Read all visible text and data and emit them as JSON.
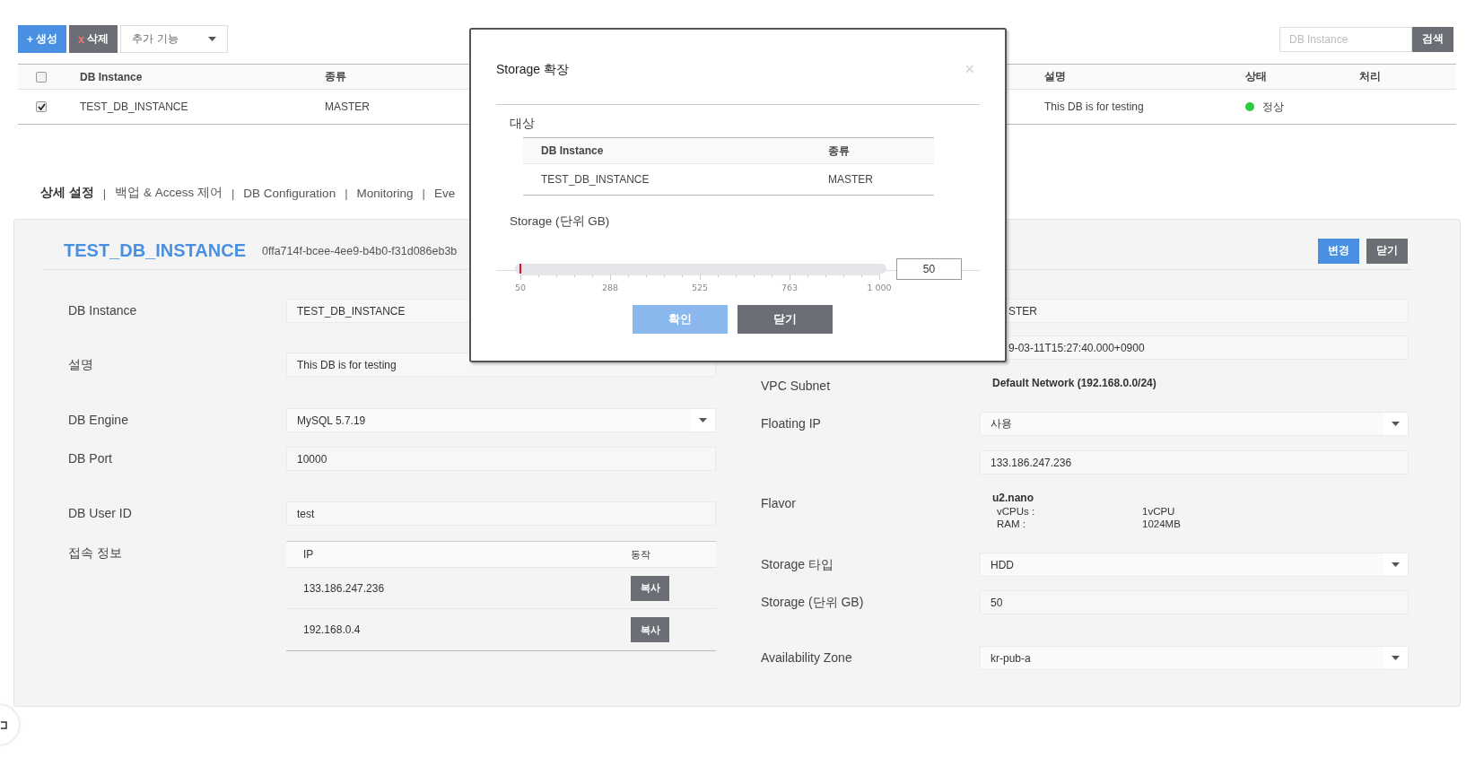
{
  "toolbar": {
    "buttons": [
      {
        "kind": "create",
        "icon": "+",
        "label": "생성"
      },
      {
        "kind": "delete",
        "icon": "x",
        "label": "삭제"
      }
    ],
    "more": {
      "label": "추가 기능"
    },
    "search": {
      "placeholder": "DB Instance",
      "button": "검색"
    }
  },
  "instances": {
    "header_checked": false,
    "columns": [
      "DB Instance",
      "종류",
      "설명",
      "상태",
      "처리"
    ],
    "rows": [
      {
        "checked": true,
        "name": "TEST_DB_INSTANCE",
        "type": "MASTER",
        "description": "This DB is for testing",
        "status": {
          "label": "정상",
          "color": "#2ecc40"
        }
      }
    ]
  },
  "tabs": [
    {
      "label": "상세 설정",
      "selected": true
    },
    {
      "label": "백업 & Access 제어",
      "selected": false
    },
    {
      "label": "DB Configuration",
      "selected": false
    },
    {
      "label": "Monitoring",
      "selected": false
    },
    {
      "label": "Eve",
      "selected": false
    }
  ],
  "tab_separators": [
    "|",
    "|",
    "|",
    "|"
  ],
  "detail": {
    "title": "TEST_DB_INSTANCE",
    "id": "0ffa714f-bcee-4ee9-b4b0-f31d086eb3b",
    "buttons": [
      {
        "kind": "primary",
        "label": "변경"
      },
      {
        "kind": "secondary",
        "label": "닫기"
      }
    ],
    "left": [
      {
        "label": "DB Instance",
        "kind": "input",
        "value": "TEST_DB_INSTANCE"
      },
      {
        "label": "설명",
        "kind": "input",
        "value": "This DB is for testing"
      },
      {
        "label": "DB Engine",
        "kind": "select",
        "value": "MySQL 5.7.19"
      },
      {
        "label": "DB Port",
        "kind": "input",
        "value": "10000"
      },
      {
        "label": "DB User ID",
        "kind": "input",
        "value": "test"
      },
      {
        "label": "접속 정보",
        "kind": "ip_table",
        "columns": [
          "IP",
          "동작"
        ],
        "rows": [
          {
            "ip": "133.186.247.236",
            "action": "복사"
          },
          {
            "ip": "192.168.0.4",
            "action": "복사"
          }
        ]
      }
    ],
    "right": [
      {
        "kind": "input",
        "value": "STER",
        "covered": true
      },
      {
        "kind": "input",
        "value": "9-03-11T15:27:40.000+0900",
        "covered": true
      },
      {
        "label": "VPC Subnet",
        "kind": "text",
        "value": "Default Network (192.168.0.0/24)"
      },
      {
        "label": "Floating IP",
        "kind": "select",
        "value": "사용"
      },
      {
        "kind": "input",
        "value": "133.186.247.236"
      },
      {
        "label": "Flavor",
        "kind": "flavor",
        "value": "u2.nano",
        "specs": [
          {
            "key": "vCPUs :",
            "value": "1vCPU"
          },
          {
            "key": "RAM :",
            "value": "1024MB"
          }
        ]
      },
      {
        "label": "Storage 타입",
        "kind": "select",
        "value": "HDD"
      },
      {
        "label": "Storage (단위 GB)",
        "kind": "input",
        "value": "50"
      },
      {
        "label": "Availability Zone",
        "kind": "select",
        "value": "kr-pub-a"
      }
    ]
  },
  "dialog": {
    "title": "Storage 확장",
    "close": "×",
    "target_label": "대상",
    "table": {
      "columns": [
        "DB Instance",
        "종류"
      ],
      "rows": [
        [
          "TEST_DB_INSTANCE",
          "MASTER"
        ]
      ]
    },
    "storage_label": "Storage (단위 GB)",
    "slider": {
      "level": 0,
      "value": "50",
      "ticks": [
        "50",
        "288",
        "525",
        "763",
        "1 000"
      ]
    },
    "buttons": [
      {
        "kind": "primary",
        "label": "확인"
      },
      {
        "kind": "secondary",
        "label": "닫기"
      }
    ]
  }
}
